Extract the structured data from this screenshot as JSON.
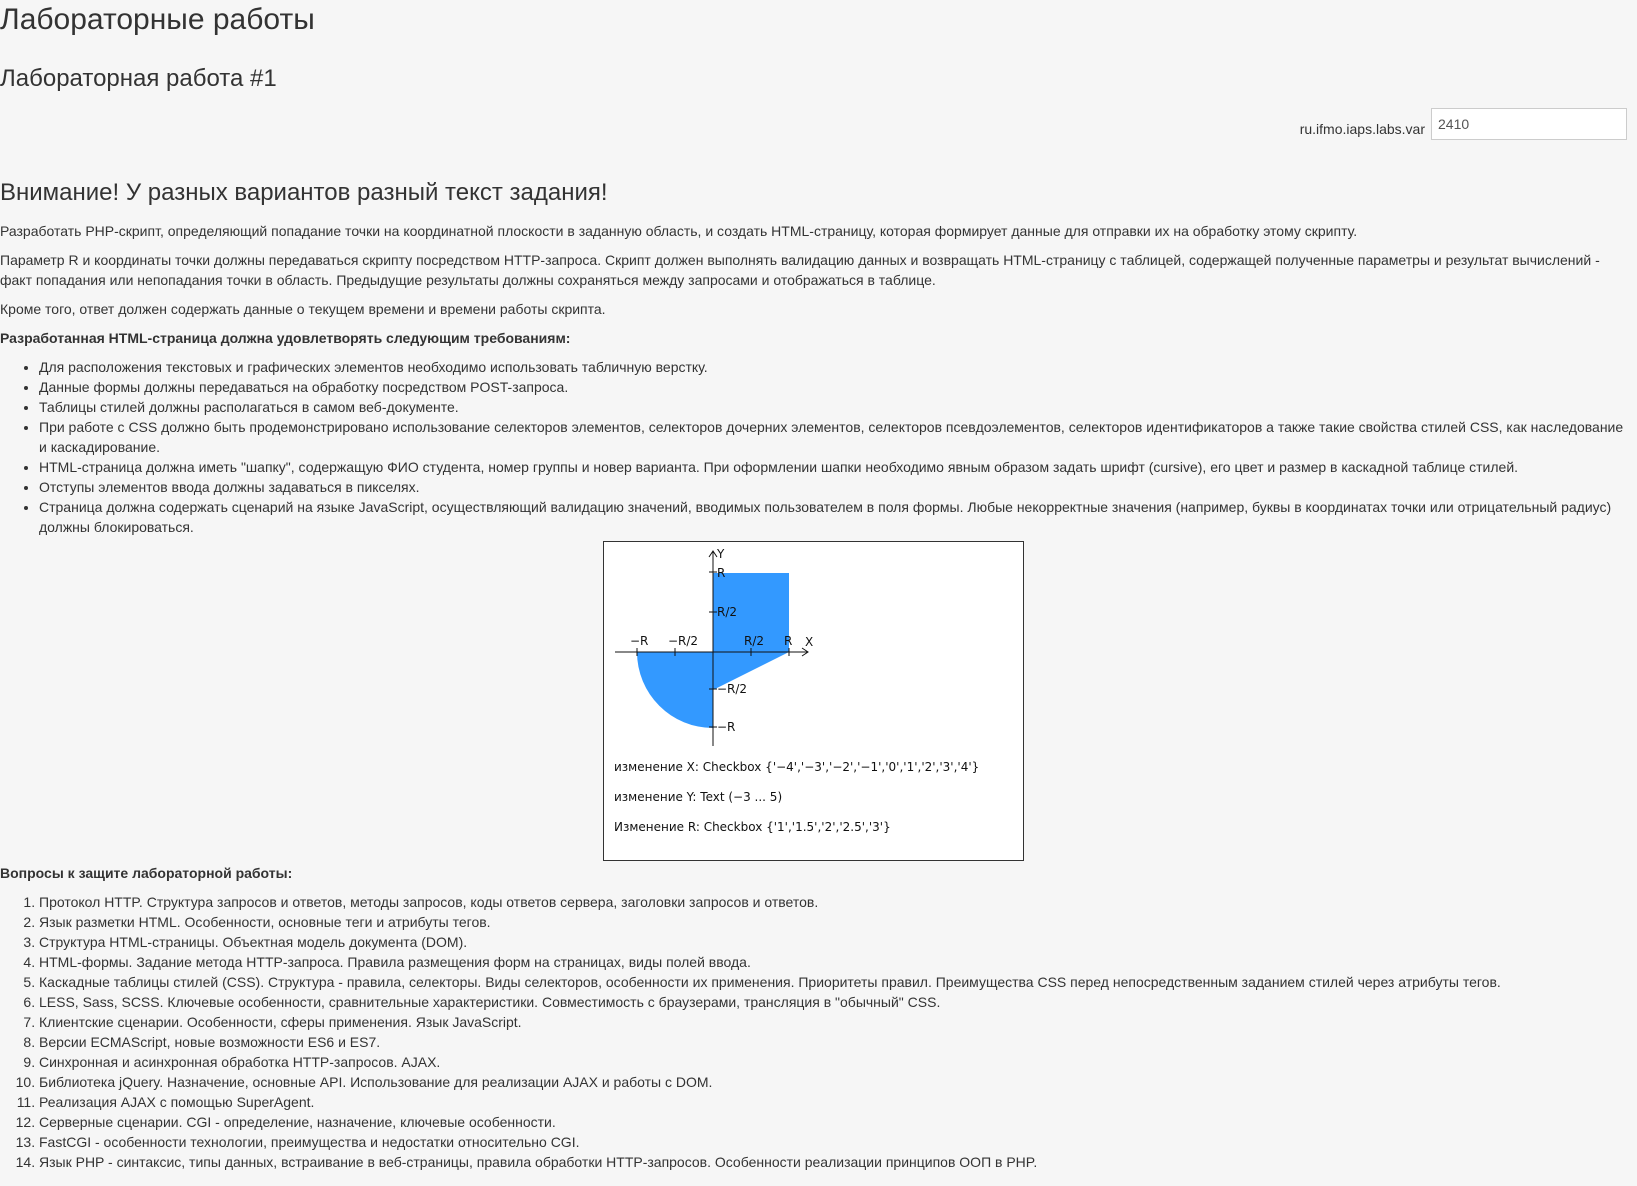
{
  "header": {
    "title": "Лабораторные работы",
    "lab_title": "Лабораторная работа #1"
  },
  "variant": {
    "label": "ru.ifmo.iaps.labs.var",
    "value": "2410"
  },
  "warning": "Внимание! У разных вариантов разный текст задания!",
  "paragraphs": [
    "Разработать PHP-скрипт, определяющий попадание точки на координатной плоскости в заданную область, и создать HTML-страницу, которая формирует данные для отправки их на обработку этому скрипту.",
    "Параметр R и координаты точки должны передаваться скрипту посредством HTTP-запроса. Скрипт должен выполнять валидацию данных и возвращать HTML-страницу с таблицей, содержащей полученные параметры и результат вычислений - факт попадания или непопадания точки в область. Предыдущие результаты должны сохраняться между запросами и отображаться в таблице.",
    "Кроме того, ответ должен содержать данные о текущем времени и времени работы скрипта."
  ],
  "requirements": {
    "heading": "Разработанная HTML-страница должна удовлетворять следующим требованиям:",
    "items": [
      "Для расположения текстовых и графических элементов необходимо использовать табличную верстку.",
      "Данные формы должны передаваться на обработку посредством POST-запроса.",
      "Таблицы стилей должны располагаться в самом веб-документе.",
      "При работе с CSS должно быть продемонстрировано использование селекторов элементов, селекторов дочерних элементов, селекторов псевдоэлементов, селекторов идентификаторов а также такие свойства стилей CSS, как наследование и каскадирование.",
      "HTML-страница должна иметь \"шапку\", содержащую ФИО студента, номер группы и новер варианта. При оформлении шапки необходимо явным образом задать шрифт (cursive), его цвет и размер в каскадной таблице стилей.",
      "Отступы элементов ввода должны задаваться в пикселях.",
      "Страница должна содержать сценарий на языке JavaScript, осуществляющий валидацию значений, вводимых пользователем в поля формы. Любые некорректные значения (например, буквы в координатах точки или отрицательный радиус) должны блокироваться."
    ]
  },
  "figure": {
    "fill_color": "#3399ff",
    "axis_labels": {
      "y": "Y",
      "x": "X",
      "R_top": "R",
      "R_half_top": "R/2",
      "neg_R_x": "−R",
      "neg_R_half_x": "−R/2",
      "R_half_x": "R/2",
      "R_x": "R",
      "neg_R_half_y": "−R/2",
      "neg_R_y": "−R"
    },
    "lines": [
      "изменение X: Checkbox {'−4','−3','−2','−1','0','1','2','3','4'}",
      "изменение Y: Text (−3 ... 5)",
      "Изменение R: Checkbox {'1','1.5','2','2.5','3'}"
    ]
  },
  "questions": {
    "heading": "Вопросы к защите лабораторной работы:",
    "items": [
      "Протокол HTTP. Структура запросов и ответов, методы запросов, коды ответов сервера, заголовки запросов и ответов.",
      "Язык разметки HTML. Особенности, основные теги и атрибуты тегов.",
      "Структура HTML-страницы. Объектная модель документа (DOM).",
      "HTML-формы. Задание метода HTTP-запроса. Правила размещения форм на страницах, виды полей ввода.",
      "Каскадные таблицы стилей (CSS). Структура - правила, селекторы. Виды селекторов, особенности их применения. Приоритеты правил. Преимущества CSS перед непосредственным заданием стилей через атрибуты тегов.",
      "LESS, Sass, SCSS. Ключевые особенности, сравнительные характеристики. Совместимость с браузерами, трансляция в \"обычный\" CSS.",
      "Клиентские сценарии. Особенности, сферы применения. Язык JavaScript.",
      "Версии ECMAScript, новые возможности ES6 и ES7.",
      "Синхронная и асинхронная обработка HTTP-запросов. AJAX.",
      "Библиотека jQuery. Назначение, основные API. Использование для реализации AJAX и работы с DOM.",
      "Реализация AJAX с помощью SuperAgent.",
      "Серверные сценарии. CGI - определение, назначение, ключевые особенности.",
      "FastCGI - особенности технологии, преимущества и недостатки относительно CGI.",
      "Язык PHP - синтаксис, типы данных, встраивание в веб-страницы, правила обработки HTTP-запросов. Особенности реализации принципов ООП в PHP."
    ]
  }
}
